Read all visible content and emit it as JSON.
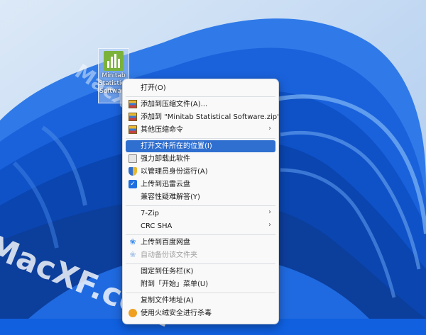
{
  "desktop": {
    "icon_label": "Minitab\nStatistica\nSoftware",
    "watermark_small": "MacXF.com",
    "watermark_large": "MacXF.com"
  },
  "menu": {
    "items": [
      {
        "label": "打开(O)"
      },
      {
        "label": "添加到压缩文件(A)..."
      },
      {
        "label": "添加到 \"Minitab Statistical Software.zip\" (T)"
      },
      {
        "label": "其他压缩命令",
        "submenu": "›"
      },
      {
        "label": "打开文件所在的位置(I)"
      },
      {
        "label": "强力卸载此软件"
      },
      {
        "label": "以管理员身份运行(A)"
      },
      {
        "label": "上传到迅雷云盘",
        "icon_glyph": "✓"
      },
      {
        "label": "兼容性疑难解答(Y)"
      },
      {
        "label": "7-Zip",
        "submenu": "›"
      },
      {
        "label": "CRC SHA",
        "submenu": "›"
      },
      {
        "label": "上传到百度网盘",
        "icon_glyph": "❀"
      },
      {
        "label": "自动备份该文件夹",
        "icon_glyph": "❀"
      },
      {
        "label": "固定到任务栏(K)"
      },
      {
        "label": "附到「开始」菜单(U)"
      },
      {
        "label": "复制文件地址(A)"
      },
      {
        "label": "使用火绒安全进行杀毒"
      }
    ]
  },
  "colors": {
    "wallpaper": "#1060e0",
    "highlight": "#2f6fd0",
    "menu_bg": "#f9f9fa"
  }
}
